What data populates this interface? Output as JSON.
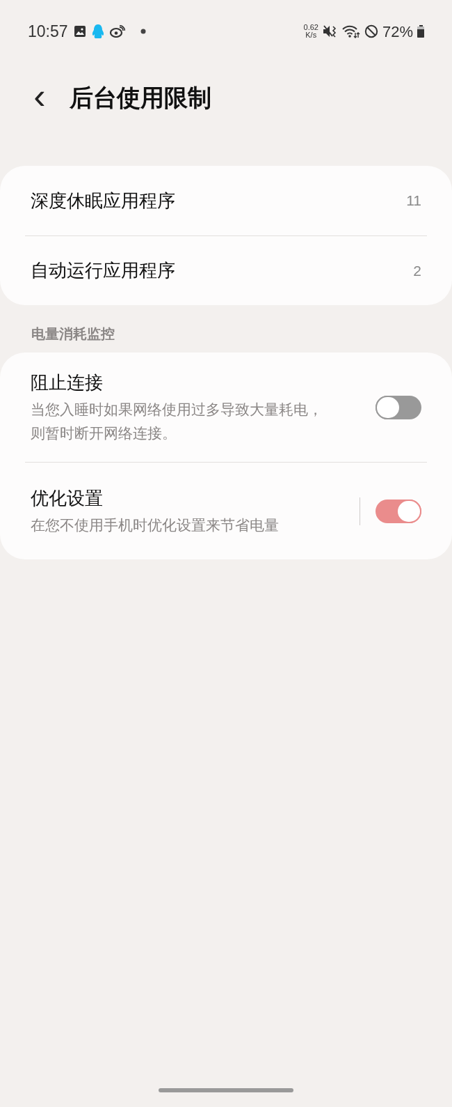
{
  "status_bar": {
    "time": "10:57",
    "net_speed_value": "0.62",
    "net_speed_unit": "K/s",
    "battery": "72%"
  },
  "header": {
    "back_glyph": "‹",
    "title": "后台使用限制"
  },
  "app_lists": [
    {
      "label": "深度休眠应用程序",
      "count": "11"
    },
    {
      "label": "自动运行应用程序",
      "count": "2"
    }
  ],
  "section": {
    "title": "电量消耗监控",
    "items": [
      {
        "title": "阻止连接",
        "description": "当您入睡时如果网络使用过多导致大量耗电，则暂时断开网络连接。",
        "on": false,
        "divider": false
      },
      {
        "title": "优化设置",
        "description": "在您不使用手机时优化设置来节省电量",
        "on": true,
        "divider": true
      }
    ]
  }
}
